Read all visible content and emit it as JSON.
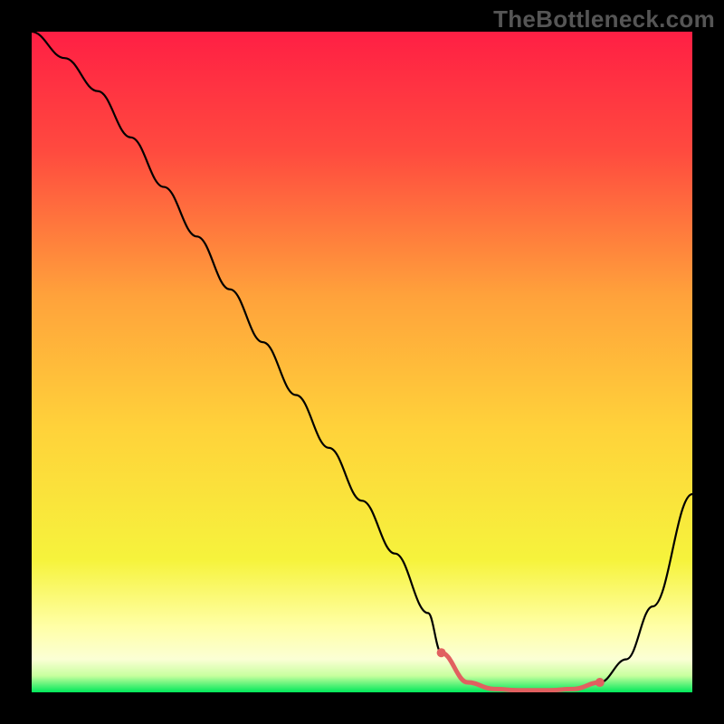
{
  "watermark": "TheBottleneck.com",
  "chart_data": {
    "type": "line",
    "x": [
      0,
      5,
      10,
      15,
      20,
      25,
      30,
      35,
      40,
      45,
      50,
      55,
      60,
      62,
      66,
      70,
      74,
      78,
      82,
      86,
      90,
      94,
      100
    ],
    "y": [
      100,
      96,
      91,
      84,
      76.5,
      69,
      61,
      53,
      45,
      37,
      29,
      21,
      12,
      6,
      1.5,
      0.5,
      0.3,
      0.3,
      0.5,
      1.5,
      5,
      13,
      30
    ],
    "xlim": [
      0,
      100
    ],
    "ylim": [
      0,
      100
    ],
    "title": "",
    "xlabel": "",
    "ylabel": "",
    "highlighted_range_x": [
      62,
      86
    ],
    "series": [
      {
        "name": "bottleneck-curve",
        "x_key": "x",
        "y_key": "y",
        "stroke": "#000000",
        "stroke_width": 2.2
      }
    ],
    "gradient_stops": [
      {
        "offset": 0.0,
        "color": "#ff1f44"
      },
      {
        "offset": 0.18,
        "color": "#ff4a3f"
      },
      {
        "offset": 0.4,
        "color": "#ffa23b"
      },
      {
        "offset": 0.6,
        "color": "#ffd23a"
      },
      {
        "offset": 0.8,
        "color": "#f6f33c"
      },
      {
        "offset": 0.9,
        "color": "#ffffa6"
      },
      {
        "offset": 0.95,
        "color": "#fbffd5"
      },
      {
        "offset": 0.975,
        "color": "#c7ff9e"
      },
      {
        "offset": 1.0,
        "color": "#00e85a"
      }
    ],
    "marker_color": "#e16060",
    "marker_radius": 5
  }
}
